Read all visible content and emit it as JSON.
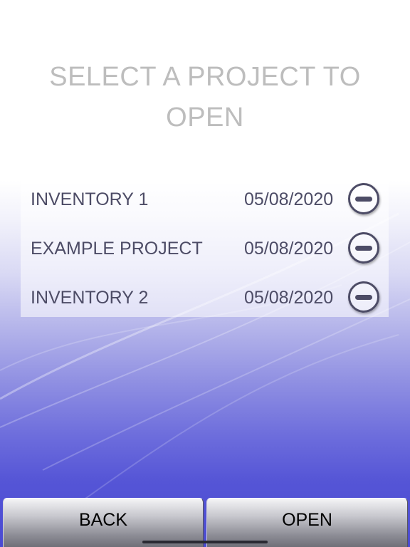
{
  "header": {
    "title_line1": "SELECT A PROJECT TO",
    "title_line2": "OPEN"
  },
  "projects": [
    {
      "name": "INVENTORY 1",
      "date": "05/08/2020",
      "delete_icon": "minus-circle-icon"
    },
    {
      "name": "EXAMPLE PROJECT",
      "date": "05/08/2020",
      "delete_icon": "minus-circle-icon"
    },
    {
      "name": "INVENTORY 2",
      "date": "05/08/2020",
      "delete_icon": "minus-circle-icon"
    }
  ],
  "footer": {
    "back_label": "BACK",
    "open_label": "OPEN"
  },
  "colors": {
    "title": "#bdbdbd",
    "text": "#4d4c66",
    "background_bottom": "#4a4ad2"
  }
}
